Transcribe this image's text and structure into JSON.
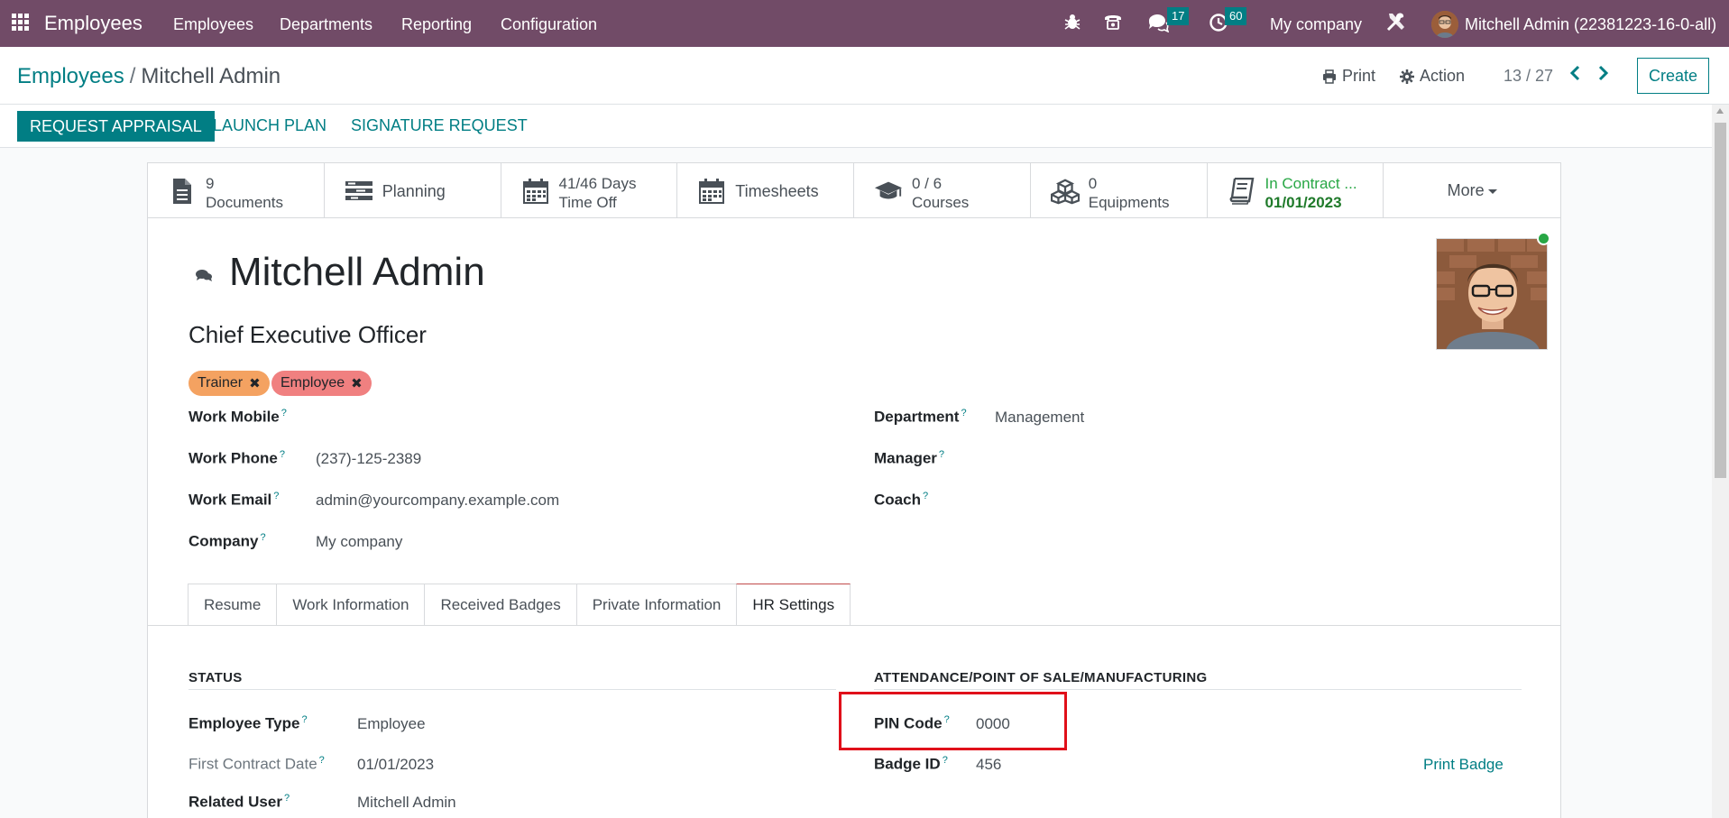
{
  "navbar": {
    "app_name": "Employees",
    "menu": [
      "Employees",
      "Departments",
      "Reporting",
      "Configuration"
    ],
    "messages_count": "17",
    "activities_count": "60",
    "company": "My company",
    "user": "Mitchell Admin (22381223-16-0-all)",
    "icons": [
      "apps-grid-icon",
      "bug-icon",
      "phone-icon",
      "chat-icon",
      "clock-icon",
      "tools-icon"
    ]
  },
  "control": {
    "breadcrumb_parent": "Employees",
    "breadcrumb_current": "Mitchell Admin",
    "print_label": "Print",
    "action_label": "Action",
    "pager": "13 / 27",
    "create_label": "Create"
  },
  "statusbar": {
    "request_appraisal": "REQUEST APPRAISAL",
    "launch_plan": "LAUNCH PLAN",
    "signature_request": "SIGNATURE REQUEST"
  },
  "smart_buttons": {
    "documents_value": "9",
    "documents_label": "Documents",
    "planning_label": "Planning",
    "timeoff_value": "41/46 Days",
    "timeoff_label": "Time Off",
    "timesheets_label": "Timesheets",
    "courses_value": "0 / 6",
    "courses_label": "Courses",
    "equipments_value": "0",
    "equipments_label": "Equipments",
    "contract_value": "In Contract ...",
    "contract_date": "01/01/2023",
    "more_label": "More"
  },
  "employee": {
    "name": "Mitchell Admin",
    "job_title": "Chief Executive Officer",
    "tags": [
      "Trainer",
      "Employee"
    ],
    "tag_colors": [
      "#f4a261",
      "#f08080"
    ]
  },
  "fields_left": {
    "work_mobile_label": "Work Mobile",
    "work_mobile_value": "",
    "work_phone_label": "Work Phone",
    "work_phone_value": "(237)-125-2389",
    "work_email_label": "Work Email",
    "work_email_value": "admin@yourcompany.example.com",
    "company_label": "Company",
    "company_value": "My company"
  },
  "fields_right": {
    "department_label": "Department",
    "department_value": "Management",
    "manager_label": "Manager",
    "coach_label": "Coach"
  },
  "tabs": [
    "Resume",
    "Work Information",
    "Received Badges",
    "Private Information",
    "HR Settings"
  ],
  "active_tab": "HR Settings",
  "hr_settings": {
    "status_title": "STATUS",
    "employee_type_label": "Employee Type",
    "employee_type_value": "Employee",
    "first_contract_label": "First Contract Date",
    "first_contract_value": "01/01/2023",
    "related_user_label": "Related User",
    "related_user_value": "Mitchell Admin",
    "attendance_title": "ATTENDANCE/POINT OF SALE/MANUFACTURING",
    "pin_code_label": "PIN Code",
    "pin_code_value": "0000",
    "badge_id_label": "Badge ID",
    "badge_id_value": "456",
    "print_badge_label": "Print Badge"
  },
  "help_mark": "?",
  "colors": {
    "brand": "#714b67",
    "accent": "#017e84",
    "highlight": "#e0101a",
    "online": "#28a745"
  }
}
